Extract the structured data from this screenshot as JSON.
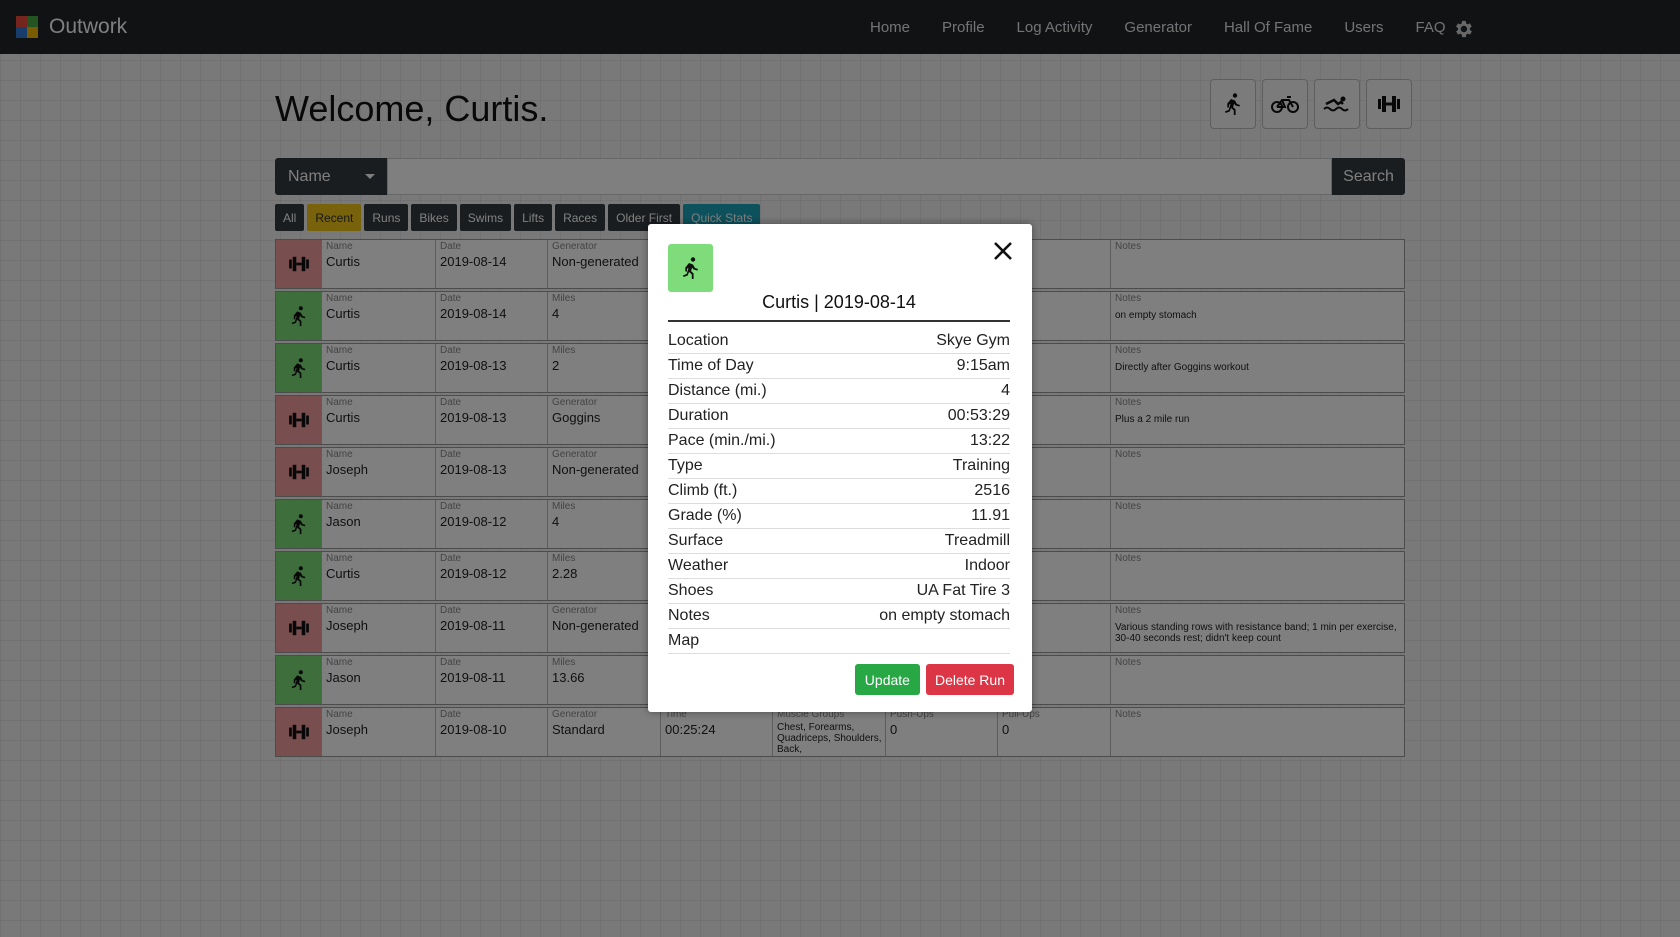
{
  "app": {
    "brand": "Outwork"
  },
  "nav": {
    "items": [
      "Home",
      "Profile",
      "Log Activity",
      "Generator",
      "Hall Of Fame",
      "Users",
      "FAQ"
    ]
  },
  "page": {
    "welcome": "Welcome, Curtis."
  },
  "search": {
    "select_value": "Name",
    "button_label": "Search"
  },
  "filters": [
    "All",
    "Recent",
    "Runs",
    "Bikes",
    "Swims",
    "Lifts",
    "Races",
    "Older First",
    "Quick Stats"
  ],
  "rows": [
    {
      "type": "lift",
      "cells": [
        {
          "label": "Name",
          "value": "Curtis"
        },
        {
          "label": "Date",
          "value": "2019-08-14"
        },
        {
          "label": "Generator",
          "value": "Non-generated"
        }
      ],
      "notes_label": "Notes",
      "notes": ""
    },
    {
      "type": "run",
      "cells": [
        {
          "label": "Name",
          "value": "Curtis"
        },
        {
          "label": "Date",
          "value": "2019-08-14"
        },
        {
          "label": "Miles",
          "value": "4"
        }
      ],
      "notes_label": "Notes",
      "notes": "on empty stomach"
    },
    {
      "type": "run",
      "cells": [
        {
          "label": "Name",
          "value": "Curtis"
        },
        {
          "label": "Date",
          "value": "2019-08-13"
        },
        {
          "label": "Miles",
          "value": "2"
        }
      ],
      "notes_label": "Notes",
      "notes": "Directly after Goggins workout"
    },
    {
      "type": "lift",
      "cells": [
        {
          "label": "Name",
          "value": "Curtis"
        },
        {
          "label": "Date",
          "value": "2019-08-13"
        },
        {
          "label": "Generator",
          "value": "Goggins"
        }
      ],
      "notes_label": "Notes",
      "notes": "Plus a 2 mile run"
    },
    {
      "type": "lift",
      "cells": [
        {
          "label": "Name",
          "value": "Joseph"
        },
        {
          "label": "Date",
          "value": "2019-08-13"
        },
        {
          "label": "Generator",
          "value": "Non-generated"
        }
      ],
      "notes_label": "Notes",
      "notes": ""
    },
    {
      "type": "run",
      "cells": [
        {
          "label": "Name",
          "value": "Jason"
        },
        {
          "label": "Date",
          "value": "2019-08-12"
        },
        {
          "label": "Miles",
          "value": "4"
        }
      ],
      "notes_label": "Notes",
      "notes": ""
    },
    {
      "type": "run",
      "cells": [
        {
          "label": "Name",
          "value": "Curtis"
        },
        {
          "label": "Date",
          "value": "2019-08-12"
        },
        {
          "label": "Miles",
          "value": "2.28"
        }
      ],
      "notes_label": "Notes",
      "notes": ""
    },
    {
      "type": "lift",
      "cells": [
        {
          "label": "Name",
          "value": "Joseph"
        },
        {
          "label": "Date",
          "value": "2019-08-11"
        },
        {
          "label": "Generator",
          "value": "Non-generated"
        }
      ],
      "notes_label": "Notes",
      "notes": "Various standing rows with resistance band; 1 min per exercise, 30-40 seconds rest; didn't keep count"
    },
    {
      "type": "run",
      "cells": [
        {
          "label": "Name",
          "value": "Jason"
        },
        {
          "label": "Date",
          "value": "2019-08-11"
        },
        {
          "label": "Miles",
          "value": "13.66"
        }
      ],
      "notes_label": "Notes",
      "notes": ""
    },
    {
      "type": "lift",
      "cells": [
        {
          "label": "Name",
          "value": "Joseph"
        },
        {
          "label": "Date",
          "value": "2019-08-10"
        },
        {
          "label": "Generator",
          "value": "Standard"
        },
        {
          "label": "Time",
          "value": "00:25:24"
        },
        {
          "label": "Muscle Groups",
          "value": "Chest, Forearms, Quadriceps, Shoulders, Back,"
        },
        {
          "label": "Push-Ups",
          "value": "0"
        },
        {
          "label": "Pull-Ups",
          "value": "0"
        }
      ],
      "notes_label": "Notes",
      "notes": ""
    }
  ],
  "modal": {
    "title": "Curtis | 2019-08-14",
    "details": [
      {
        "label": "Location",
        "value": "Skye Gym"
      },
      {
        "label": "Time of Day",
        "value": "9:15am"
      },
      {
        "label": "Distance (mi.)",
        "value": "4"
      },
      {
        "label": "Duration",
        "value": "00:53:29"
      },
      {
        "label": "Pace (min./mi.)",
        "value": "13:22"
      },
      {
        "label": "Type",
        "value": "Training"
      },
      {
        "label": "Climb (ft.)",
        "value": "2516"
      },
      {
        "label": "Grade (%)",
        "value": "11.91"
      },
      {
        "label": "Surface",
        "value": "Treadmill"
      },
      {
        "label": "Weather",
        "value": "Indoor"
      },
      {
        "label": "Shoes",
        "value": "UA Fat Tire 3"
      },
      {
        "label": "Notes",
        "value": "on empty stomach"
      },
      {
        "label": "Map",
        "value": ""
      }
    ],
    "update_label": "Update",
    "delete_label": "Delete Run"
  },
  "colors": {
    "run": "#7edc7b",
    "lift": "#f29c9c",
    "recent": "#f0c419",
    "stats": "#1aa2b8",
    "update": "#28a745",
    "delete": "#dc3545"
  },
  "icons": {
    "run": "runner-icon",
    "bike": "bike-icon",
    "swim": "swimmer-icon",
    "lift": "dumbbell-icon",
    "settings": "gear-icon",
    "close": "close-icon"
  }
}
